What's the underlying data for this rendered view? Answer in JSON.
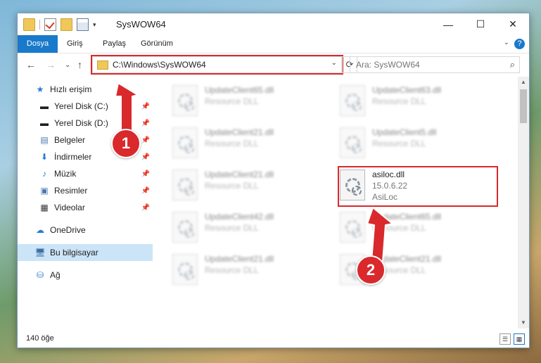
{
  "titlebar": {
    "title": "SysWOW64",
    "minimize": "—",
    "maximize": "☐",
    "close": "✕"
  },
  "ribbon": {
    "tabs": [
      "Dosya",
      "Giriş",
      "Paylaş",
      "Görünüm"
    ],
    "help": "?"
  },
  "nav": {
    "address": "C:\\Windows\\SysWOW64",
    "search_placeholder": "Ara: SysWOW64"
  },
  "sidebar": {
    "quick_access": "Hızlı erişim",
    "items": [
      {
        "label": "Yerel Disk (C:)"
      },
      {
        "label": "Yerel Disk (D:)"
      },
      {
        "label": "Belgeler"
      },
      {
        "label": "İndirmeler"
      },
      {
        "label": "Müzik"
      },
      {
        "label": "Resimler"
      },
      {
        "label": "Videolar"
      }
    ],
    "onedrive": "OneDrive",
    "this_pc": "Bu bilgisayar",
    "network": "Ağ"
  },
  "files": [
    {
      "name": "UpdateClient65.dll",
      "line1": "Resource DLL",
      "line2": ""
    },
    {
      "name": "UpdateClient63.dll",
      "line1": "Resource DLL",
      "line2": ""
    },
    {
      "name": "UpdateClient21.dll",
      "line1": "Resource DLL",
      "line2": ""
    },
    {
      "name": "UpdateClient5.dll",
      "line1": "Resource DLL",
      "line2": ""
    },
    {
      "name": "UpdateClient21.dll",
      "line1": "Resource DLL",
      "line2": ""
    },
    {
      "name": "asiloc.dll",
      "line1": "15.0.6.22",
      "line2": "AsiLoc"
    },
    {
      "name": "UpdateClient42.dll",
      "line1": "Resource DLL",
      "line2": ""
    },
    {
      "name": "UpdateClient65.dll",
      "line1": "Resource DLL",
      "line2": ""
    },
    {
      "name": "UpdateClient21.dll",
      "line1": "Resource DLL",
      "line2": ""
    },
    {
      "name": "UpdateClient21.dll",
      "line1": "Resource DLL",
      "line2": ""
    }
  ],
  "status": {
    "item_count": "140 öğe"
  },
  "markers": {
    "one": "1",
    "two": "2"
  },
  "colors": {
    "accent": "#1979ca",
    "highlight": "#d9292c",
    "selection": "#cce4f7"
  }
}
